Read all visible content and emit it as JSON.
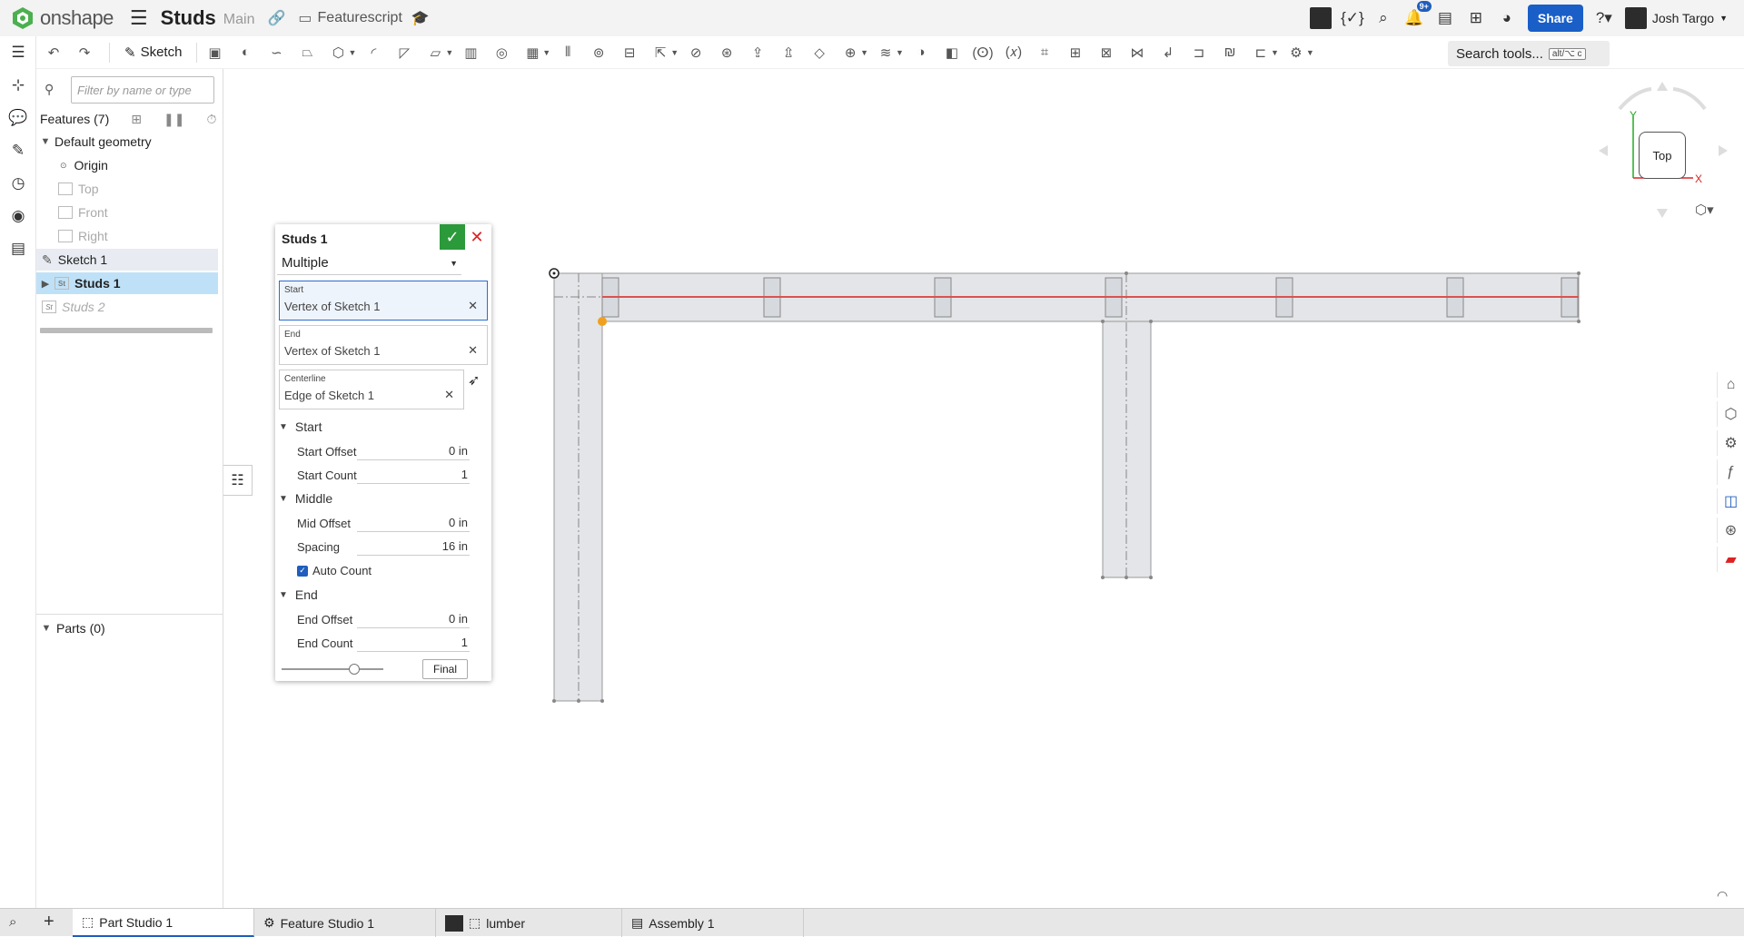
{
  "topbar": {
    "brand": "onshape",
    "document_title": "Studs",
    "branch": "Main",
    "folder": "Featurescript",
    "notifications_badge": "9+",
    "share_label": "Share",
    "user_name": "Josh Targo"
  },
  "toolbar": {
    "sketch_label": "Sketch",
    "search_label": "Search tools...",
    "search_shortcut": "alt/⌥ c"
  },
  "tree": {
    "filter_placeholder": "Filter by name or type",
    "features_header": "Features (7)",
    "default_geometry": "Default geometry",
    "origin": "Origin",
    "top": "Top",
    "front": "Front",
    "right": "Right",
    "sketch1": "Sketch 1",
    "studs1": "Studs 1",
    "studs2": "Studs 2",
    "parts": "Parts (0)"
  },
  "dialog": {
    "title": "Studs 1",
    "mode": "Multiple",
    "start_query": {
      "label": "Start",
      "value": "Vertex of Sketch 1"
    },
    "end_query": {
      "label": "End",
      "value": "Vertex of Sketch 1"
    },
    "centerline_query": {
      "label": "Centerline",
      "value": "Edge of Sketch 1"
    },
    "section_start": "Start",
    "start_offset": {
      "label": "Start Offset",
      "value": "0 in"
    },
    "start_count": {
      "label": "Start Count",
      "value": "1"
    },
    "section_middle": "Middle",
    "mid_offset": {
      "label": "Mid Offset",
      "value": "0 in"
    },
    "spacing": {
      "label": "Spacing",
      "value": "16 in"
    },
    "auto_count": {
      "label": "Auto Count",
      "checked": true
    },
    "section_end": "End",
    "end_offset": {
      "label": "End Offset",
      "value": "0 in"
    },
    "end_count": {
      "label": "End Count",
      "value": "1"
    },
    "final_label": "Final"
  },
  "viewcube": {
    "face": "Top",
    "axis_x": "X",
    "axis_y": "Y"
  },
  "bottom_tabs": [
    {
      "label": "Part Studio 1",
      "active": true
    },
    {
      "label": "Feature Studio 1",
      "active": false
    },
    {
      "label": "lumber",
      "active": false
    },
    {
      "label": "Assembly 1",
      "active": false
    }
  ],
  "colors": {
    "accent": "#1f5ebc",
    "ok": "#2b9a3a",
    "cancel": "#dd2222",
    "selection": "#bfe1f7",
    "centerline": "#d9534f",
    "vertex": "#f0a020"
  }
}
